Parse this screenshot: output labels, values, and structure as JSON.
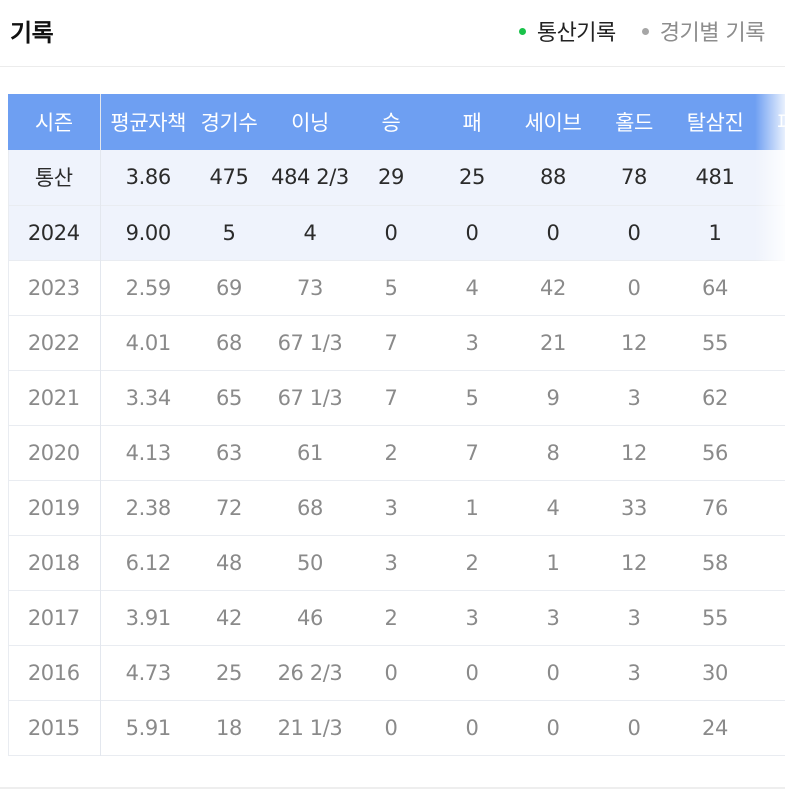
{
  "header": {
    "title": "기록",
    "tabs": [
      {
        "label": "통산기록",
        "active": true
      },
      {
        "label": "경기별 기록",
        "active": false
      }
    ]
  },
  "colors": {
    "header_bg": "#6e9ff2",
    "highlight_row_bg": "#eff3fc",
    "active_dot": "#19c24a",
    "inactive_dot": "#a6a6a6"
  },
  "table": {
    "columns": [
      "시즌",
      "평균자책",
      "경기수",
      "이닝",
      "승",
      "패",
      "세이브",
      "홀드",
      "탈삼진",
      "피"
    ],
    "rows": [
      {
        "season": "통산",
        "era": "3.86",
        "games": "475",
        "innings": "484 2/3",
        "w": "29",
        "l": "25",
        "sv": "88",
        "hld": "78",
        "so": "481",
        "extra": ""
      },
      {
        "season": "2024",
        "era": "9.00",
        "games": "5",
        "innings": "4",
        "w": "0",
        "l": "0",
        "sv": "0",
        "hld": "0",
        "so": "1",
        "extra": ""
      },
      {
        "season": "2023",
        "era": "2.59",
        "games": "69",
        "innings": "73",
        "w": "5",
        "l": "4",
        "sv": "42",
        "hld": "0",
        "so": "64",
        "extra": ""
      },
      {
        "season": "2022",
        "era": "4.01",
        "games": "68",
        "innings": "67 1/3",
        "w": "7",
        "l": "3",
        "sv": "21",
        "hld": "12",
        "so": "55",
        "extra": ""
      },
      {
        "season": "2021",
        "era": "3.34",
        "games": "65",
        "innings": "67 1/3",
        "w": "7",
        "l": "5",
        "sv": "9",
        "hld": "3",
        "so": "62",
        "extra": ""
      },
      {
        "season": "2020",
        "era": "4.13",
        "games": "63",
        "innings": "61",
        "w": "2",
        "l": "7",
        "sv": "8",
        "hld": "12",
        "so": "56",
        "extra": ""
      },
      {
        "season": "2019",
        "era": "2.38",
        "games": "72",
        "innings": "68",
        "w": "3",
        "l": "1",
        "sv": "4",
        "hld": "33",
        "so": "76",
        "extra": ""
      },
      {
        "season": "2018",
        "era": "6.12",
        "games": "48",
        "innings": "50",
        "w": "3",
        "l": "2",
        "sv": "1",
        "hld": "12",
        "so": "58",
        "extra": ""
      },
      {
        "season": "2017",
        "era": "3.91",
        "games": "42",
        "innings": "46",
        "w": "2",
        "l": "3",
        "sv": "3",
        "hld": "3",
        "so": "55",
        "extra": ""
      },
      {
        "season": "2016",
        "era": "4.73",
        "games": "25",
        "innings": "26 2/3",
        "w": "0",
        "l": "0",
        "sv": "0",
        "hld": "3",
        "so": "30",
        "extra": ""
      },
      {
        "season": "2015",
        "era": "5.91",
        "games": "18",
        "innings": "21 1/3",
        "w": "0",
        "l": "0",
        "sv": "0",
        "hld": "0",
        "so": "24",
        "extra": ""
      }
    ]
  }
}
